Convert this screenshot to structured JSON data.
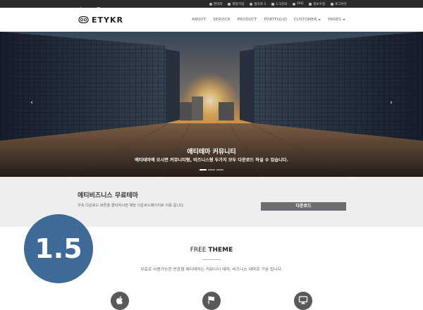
{
  "topbar": {
    "social": [
      "facebook-icon",
      "twitter-icon",
      "instagram-icon"
    ],
    "links": [
      {
        "icon": "admin-icon",
        "label": "관리자"
      },
      {
        "icon": "signup-icon",
        "label": "회원가입"
      },
      {
        "icon": "user-icon",
        "label": "접속자 1"
      },
      {
        "icon": "message-icon",
        "label": "1:1문의"
      },
      {
        "icon": "question-icon",
        "label": "FAQ"
      },
      {
        "icon": "edit-icon",
        "label": "정보수정"
      },
      {
        "icon": "logout-icon",
        "label": "로그아웃"
      }
    ]
  },
  "header": {
    "logo_text": "ETYKR",
    "nav": [
      {
        "label": "ABOUT",
        "dropdown": false
      },
      {
        "label": "SERVICE",
        "dropdown": false
      },
      {
        "label": "PRODUCT",
        "dropdown": false
      },
      {
        "label": "PORTFOLIO",
        "dropdown": false
      },
      {
        "label": "CUSTOMER",
        "dropdown": true
      },
      {
        "label": "PAGES",
        "dropdown": true
      }
    ]
  },
  "hero": {
    "title": "에티테마 커뮤니티",
    "subtitle": "에티테마에 오시면 커뮤니티형, 비즈니스형 두가지 모두 다운로드 하실 수 있습니다.",
    "prev_arrow": "‹",
    "next_arrow": "›",
    "slides": 3,
    "active_slide": 1
  },
  "download": {
    "title": "에티비즈니스 무료테마",
    "description": "우측 다운로드 버튼을 클릭하시면 해당 다운로드페이지로 이동 됩니다.",
    "button_label": "다운로드"
  },
  "badge": {
    "label": "1.5"
  },
  "free_theme": {
    "title_regular": "FREE ",
    "title_bold": "THEME",
    "description": "무료로 사용가능한 반응형 에티테마는 커뮤니티 테마, 비즈니스 테마로 구분 됩니다.",
    "features": [
      "apple-icon",
      "flag-icon",
      "monitor-icon"
    ]
  },
  "colors": {
    "topbar_bg": "#2b2b2b",
    "band_bg": "#eeeeee",
    "button_bg": "#6b6e72",
    "badge_bg": "#3d6a96"
  }
}
